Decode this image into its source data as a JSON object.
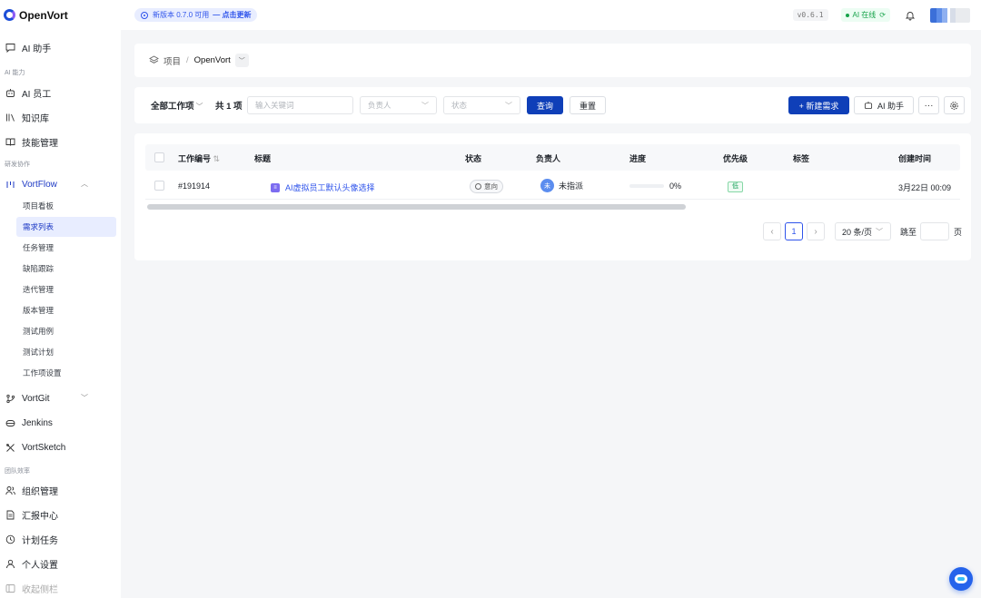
{
  "app": {
    "name": "OpenVort"
  },
  "topbar": {
    "update_text": "新版本 0.7.0 可用",
    "update_link": "— 点击更新",
    "version": "v0.6.1",
    "ai_status": "AI 在线"
  },
  "sidebar": {
    "ai_assistant": "AI 助手",
    "section_ai": "AI 能力",
    "ai_employee": "AI 员工",
    "knowledge": "知识库",
    "skills": "技能管理",
    "section_dev": "研发协作",
    "vortflow": "VortFlow",
    "sub_items": [
      "项目看板",
      "需求列表",
      "任务管理",
      "缺陷跟踪",
      "迭代管理",
      "版本管理",
      "测试用例",
      "测试计划",
      "工作项设置"
    ],
    "vortgit": "VortGit",
    "jenkins": "Jenkins",
    "vortsketch": "VortSketch",
    "section_team": "团队效率",
    "org": "组织管理",
    "report": "汇报中心",
    "schedule": "计划任务",
    "personal": "个人设置",
    "collapse": "收起侧栏"
  },
  "breadcrumb": {
    "root": "项目",
    "sep": "/",
    "project": "OpenVort"
  },
  "filters": {
    "scope": "全部工作项",
    "count": "共 1 项",
    "keyword_placeholder": "输入关键词",
    "assignee_placeholder": "负责人",
    "status_placeholder": "状态",
    "query": "查询",
    "reset": "重置",
    "new": "+ 新建需求",
    "ai": "AI 助手",
    "more": "···"
  },
  "table": {
    "columns": [
      "工作编号",
      "标题",
      "状态",
      "负责人",
      "进度",
      "优先级",
      "标签",
      "创建时间"
    ],
    "rows": [
      {
        "id": "#191914",
        "title": "AI虚拟员工默认头像选择",
        "status": "意向",
        "assignee_avatar": "未",
        "assignee": "未指派",
        "progress": 0,
        "progress_text": "0%",
        "priority": "低",
        "tags": "",
        "created": "3月22日 00:09"
      }
    ]
  },
  "pagination": {
    "current": "1",
    "page_size": "20 条/页",
    "jump_label": "跳至",
    "jump_suffix": "页"
  },
  "colors": {
    "primary": "#0f3fb8",
    "accent": "#2f54eb",
    "active_bg": "#e8edff",
    "online": "#16a34a"
  }
}
